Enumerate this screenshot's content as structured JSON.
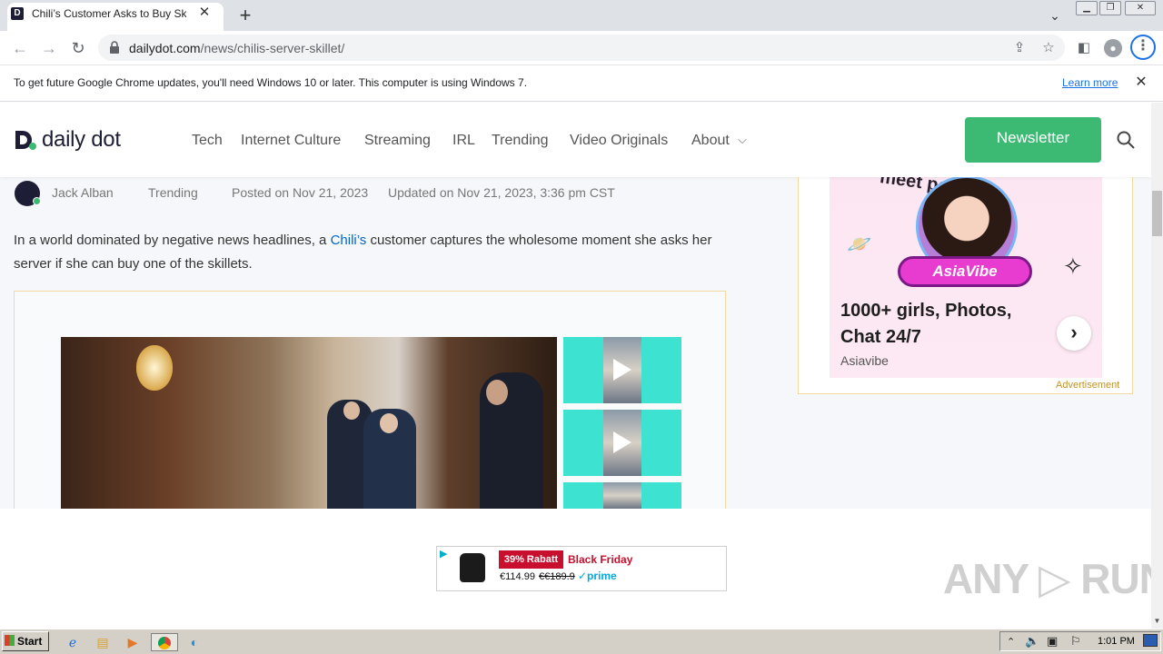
{
  "browser": {
    "tab_title": "Chili’s Customer Asks to Buy Skillet A",
    "tab_favicon": "D",
    "new_tab_symbol": "+",
    "url_host": "dailydot.com",
    "url_path": "/news/chilis-server-skillet/"
  },
  "infobar": {
    "message": "To get future Google Chrome updates, you'll need Windows 10 or later. This computer is using Windows 7.",
    "link": "Learn more"
  },
  "site": {
    "logo_text": "daily dot",
    "nav": [
      "Tech",
      "Internet Culture",
      "Streaming",
      "IRL",
      "Trending",
      "Video Originals",
      "About"
    ],
    "newsletter_label": "Newsletter"
  },
  "byline": {
    "author": "Jack Alban",
    "category": "Trending",
    "posted": "Posted on Nov 21, 2023",
    "updated": "Updated on Nov 21, 2023, 3:36 pm CST"
  },
  "article": {
    "text_before": "In a world dominated by negative news headlines, a ",
    "link": "Chili’s",
    "text_after": " customer captures the wholesome moment she asks her server if she can buy one of the skillets."
  },
  "side_ad": {
    "top_text": "meet people",
    "brand": "AsiaVibe",
    "headline": "1000+ girls, Photos, Chat 24/7",
    "source": "Asiavibe",
    "label": "Advertisement"
  },
  "bottom_ad": {
    "discount": "39% Rabatt",
    "promo": "Black Friday",
    "price": "€114.99",
    "old_price": "€€189.9",
    "prime": "✓prime"
  },
  "watermark": "ANY ▷ RUN",
  "taskbar": {
    "start_label": "Start",
    "clock": "1:01 PM"
  },
  "colors": {
    "accent_green": "#3cba74",
    "brand_navy": "#1d1d35",
    "link_blue": "#0066cc"
  }
}
